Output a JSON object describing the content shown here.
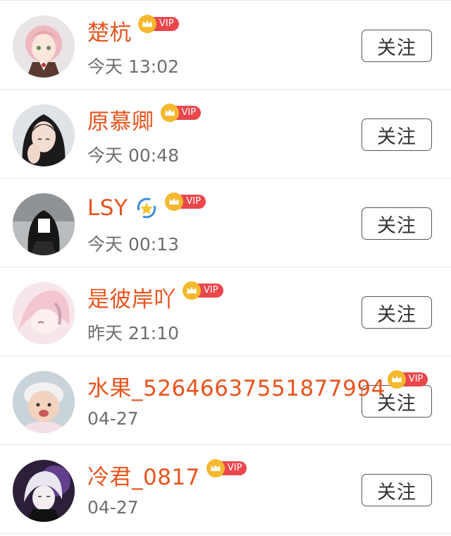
{
  "users": [
    {
      "name": "楚杭",
      "time": "今天 13:02",
      "vip_label": "VIP",
      "follow_label": "关注",
      "avatar": "anime-girl-pink-hair"
    },
    {
      "name": "原慕卿",
      "time": "今天 00:48",
      "vip_label": "VIP",
      "follow_label": "关注",
      "avatar": "woman-photo"
    },
    {
      "name": "LSY",
      "time": "今天 00:13",
      "vip_label": "VIP",
      "follow_label": "关注",
      "avatar": "dark-hair-girl",
      "emoji": "star-orbit-emoji"
    },
    {
      "name": "是彼岸吖",
      "time": "昨天 21:10",
      "vip_label": "VIP",
      "follow_label": "关注",
      "avatar": "anime-pink-character"
    },
    {
      "name": "水果_52646637551877994",
      "time": "04-27",
      "vip_label": "VIP",
      "follow_label": "关注",
      "avatar": "baby-photo"
    },
    {
      "name": "冷君_0817",
      "time": "04-27",
      "vip_label": "VIP",
      "follow_label": "关注",
      "avatar": "anime-boy-purple"
    }
  ],
  "colors": {
    "name": "#e8541e",
    "vip_tag": "#e9474c",
    "crown": "#f5b82e",
    "time": "#6e6e6e",
    "divider": "#e6e6e6"
  }
}
